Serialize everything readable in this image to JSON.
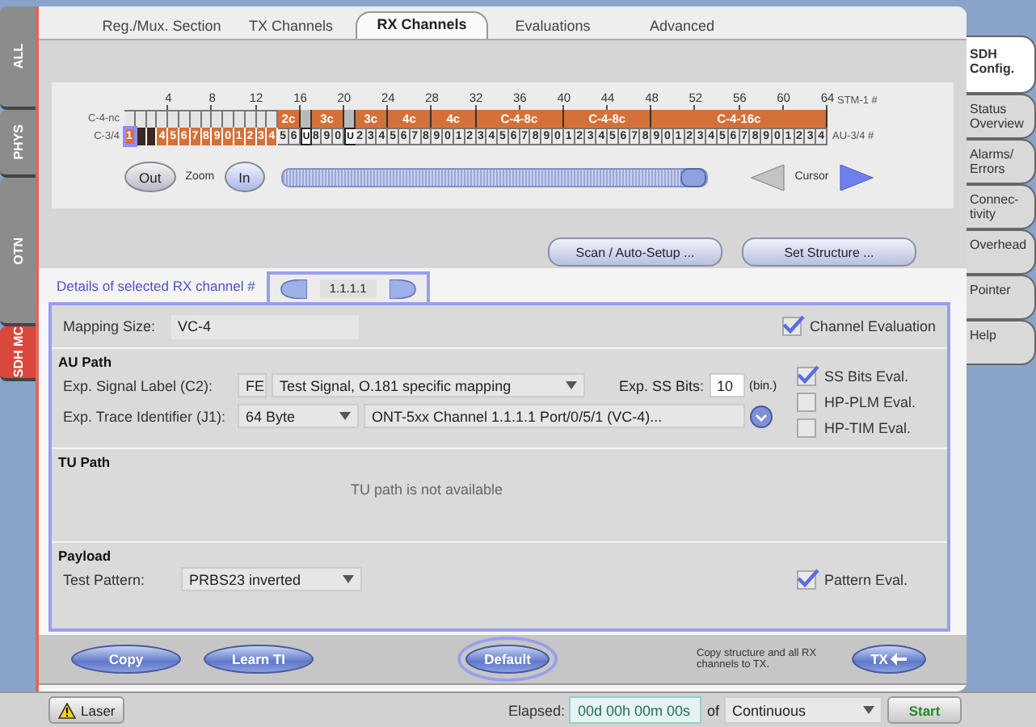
{
  "side_tabs": [
    {
      "label": "ALL",
      "selected": false
    },
    {
      "label": "PHYS",
      "selected": false
    },
    {
      "label": "OTN",
      "selected": false
    },
    {
      "label": "SDH MC",
      "selected": true
    }
  ],
  "tabs": [
    {
      "label": "Reg./Mux. Section",
      "selected": false
    },
    {
      "label": "TX Channels",
      "selected": false
    },
    {
      "label": "RX Channels",
      "selected": true
    },
    {
      "label": "Evaluations",
      "selected": false
    },
    {
      "label": "Advanced",
      "selected": false
    }
  ],
  "right_tabs": [
    {
      "label": "SDH Config.",
      "selected": true
    },
    {
      "label": "Status Overview",
      "selected": false
    },
    {
      "label": "Alarms/ Errors",
      "selected": false
    },
    {
      "label": "Connec-tivity",
      "selected": false
    },
    {
      "label": "Overhead",
      "selected": false
    },
    {
      "label": "Pointer",
      "selected": false
    },
    {
      "label": "Help",
      "selected": false
    }
  ],
  "channel_map": {
    "ruler_ticks": [
      "4",
      "8",
      "12",
      "16",
      "20",
      "24",
      "28",
      "32",
      "36",
      "40",
      "44",
      "48",
      "52",
      "56",
      "60",
      "64"
    ],
    "ruler_label": "STM-1 #",
    "nc_label": "C-4-nc",
    "au_row_label": "C-3/4",
    "au_label": "AU-3/4 #",
    "groups": [
      {
        "kind": "empty",
        "cells": [
          {
            "kind": "selected",
            "label": "1"
          }
        ]
      },
      {
        "kind": "empty",
        "cells": [
          {
            "kind": "dark"
          }
        ]
      },
      {
        "kind": "empty",
        "cells": [
          {
            "kind": "dark"
          }
        ]
      },
      {
        "kind": "empty",
        "cells": [
          {
            "kind": "orange",
            "label": "4"
          }
        ]
      },
      {
        "kind": "empty",
        "cells": [
          {
            "kind": "orange",
            "label": "5"
          }
        ]
      },
      {
        "kind": "empty",
        "cells": [
          {
            "kind": "orange",
            "label": "6"
          }
        ]
      },
      {
        "kind": "empty",
        "cells": [
          {
            "kind": "orange",
            "label": "7"
          }
        ]
      },
      {
        "kind": "empty",
        "cells": [
          {
            "kind": "orange",
            "label": "8"
          }
        ]
      },
      {
        "kind": "empty",
        "cells": [
          {
            "kind": "orange",
            "label": "9"
          }
        ]
      },
      {
        "kind": "empty",
        "cells": [
          {
            "kind": "orange",
            "label": "0"
          }
        ]
      },
      {
        "kind": "empty",
        "cells": [
          {
            "kind": "orange",
            "label": "1"
          }
        ]
      },
      {
        "kind": "empty",
        "cells": [
          {
            "kind": "orange",
            "label": "2"
          }
        ]
      },
      {
        "kind": "empty",
        "cells": [
          {
            "kind": "orange",
            "label": "3"
          }
        ]
      },
      {
        "kind": "empty",
        "cells": [
          {
            "kind": "orange",
            "label": "4"
          }
        ]
      },
      {
        "kind": "block",
        "label": "2c",
        "cells": [
          {
            "kind": "grey",
            "label": "5"
          },
          {
            "kind": "grey",
            "label": "6"
          }
        ]
      },
      {
        "kind": "grey",
        "cells": [
          {
            "kind": "unequipped",
            "label": "U"
          }
        ]
      },
      {
        "kind": "block",
        "label": "3c",
        "cells": [
          {
            "kind": "grey",
            "label": "8"
          },
          {
            "kind": "grey",
            "label": "9"
          },
          {
            "kind": "grey",
            "label": "0"
          }
        ]
      },
      {
        "kind": "grey",
        "cells": [
          {
            "kind": "unequipped",
            "label": "U"
          }
        ]
      },
      {
        "kind": "block",
        "label": "3c",
        "cells": [
          {
            "kind": "grey",
            "label": "2"
          },
          {
            "kind": "grey",
            "label": "3"
          },
          {
            "kind": "grey",
            "label": "4"
          }
        ]
      },
      {
        "kind": "block",
        "label": "4c",
        "cells": [
          {
            "kind": "grey",
            "label": "5"
          },
          {
            "kind": "grey",
            "label": "6"
          },
          {
            "kind": "grey",
            "label": "7"
          },
          {
            "kind": "grey",
            "label": "8"
          }
        ]
      },
      {
        "kind": "block",
        "label": "4c",
        "cells": [
          {
            "kind": "grey",
            "label": "9"
          },
          {
            "kind": "grey",
            "label": "0"
          },
          {
            "kind": "grey",
            "label": "1"
          },
          {
            "kind": "grey",
            "label": "2"
          }
        ]
      },
      {
        "kind": "block",
        "label": "C-4-8c",
        "cells": [
          {
            "kind": "grey",
            "label": "3"
          },
          {
            "kind": "grey",
            "label": "4"
          },
          {
            "kind": "grey",
            "label": "5"
          },
          {
            "kind": "grey",
            "label": "6"
          },
          {
            "kind": "grey",
            "label": "7"
          },
          {
            "kind": "grey",
            "label": "8"
          },
          {
            "kind": "grey",
            "label": "9"
          },
          {
            "kind": "grey",
            "label": "0"
          }
        ]
      },
      {
        "kind": "block",
        "label": "C-4-8c",
        "cells": [
          {
            "kind": "grey",
            "label": "1"
          },
          {
            "kind": "grey",
            "label": "2"
          },
          {
            "kind": "grey",
            "label": "3"
          },
          {
            "kind": "grey",
            "label": "4"
          },
          {
            "kind": "grey",
            "label": "5"
          },
          {
            "kind": "grey",
            "label": "6"
          },
          {
            "kind": "grey",
            "label": "7"
          },
          {
            "kind": "grey",
            "label": "8"
          }
        ]
      },
      {
        "kind": "block",
        "label": "C-4-16c",
        "cells": [
          {
            "kind": "grey",
            "label": "9"
          },
          {
            "kind": "grey",
            "label": "0"
          },
          {
            "kind": "grey",
            "label": "1"
          },
          {
            "kind": "grey",
            "label": "2"
          },
          {
            "kind": "grey",
            "label": "3"
          },
          {
            "kind": "grey",
            "label": "4"
          },
          {
            "kind": "grey",
            "label": "5"
          },
          {
            "kind": "grey",
            "label": "6"
          },
          {
            "kind": "grey",
            "label": "7"
          },
          {
            "kind": "grey",
            "label": "8"
          },
          {
            "kind": "grey",
            "label": "9"
          },
          {
            "kind": "grey",
            "label": "0"
          },
          {
            "kind": "grey",
            "label": "1"
          },
          {
            "kind": "grey",
            "label": "2"
          },
          {
            "kind": "grey",
            "label": "3"
          },
          {
            "kind": "grey",
            "label": "4"
          }
        ]
      }
    ]
  },
  "zoom": {
    "out_label": "Out",
    "label": "Zoom",
    "in_label": "In",
    "level": 1
  },
  "cursor": {
    "label": "Cursor",
    "previous": {
      "disabled": true
    },
    "next": {
      "disabled": false
    }
  },
  "structure_buttons": [
    {
      "label": "Scan / Auto-Setup ..."
    },
    {
      "label": "Set Structure ..."
    }
  ],
  "details": {
    "label": "Details of selected RX channel #",
    "channel": "1.1.1.1",
    "mapping_size": {
      "label": "Mapping Size:",
      "value": "VC-4"
    },
    "channel_evaluation": {
      "label": "Channel Evaluation",
      "checked": true
    },
    "au_path": {
      "title": "AU Path",
      "signal_label": {
        "label": "Exp. Signal Label (C2):",
        "code": "FE",
        "value": "Test Signal, O.181 specific mapping"
      },
      "ss_bits": {
        "label": "Exp. SS Bits:",
        "value": "10",
        "unit": "(bin.)"
      },
      "trace": {
        "label": "Exp. Trace Identifier (J1):",
        "format": "64 Byte",
        "value": "ONT-5xx Channel 1.1.1.1 Port/0/5/1 (VC-4)..."
      },
      "evaluations": [
        {
          "label": "SS Bits Eval.",
          "checked": true
        },
        {
          "label": "HP-PLM Eval.",
          "checked": false
        },
        {
          "label": "HP-TIM Eval.",
          "checked": false
        }
      ]
    },
    "tu_path": {
      "title": "TU Path",
      "message": "TU path is not available"
    },
    "payload": {
      "title": "Payload",
      "label": "Test Pattern:",
      "value": "PRBS23 inverted",
      "evaluation": {
        "label": "Pattern Eval.",
        "checked": true
      }
    }
  },
  "actions": {
    "buttons": [
      {
        "label": "Copy",
        "focused": false
      },
      {
        "label": "Learn TI",
        "focused": false
      },
      {
        "label": "Default",
        "focused": true
      }
    ],
    "hint": "Copy structure and all RX channels to TX.",
    "tx_label": "TX"
  },
  "status_bar": {
    "laser": "Laser",
    "elapsed_label": "Elapsed:",
    "elapsed": "00d 00h 00m 00s",
    "of": "of",
    "duration": "Continuous",
    "start": "Start"
  }
}
